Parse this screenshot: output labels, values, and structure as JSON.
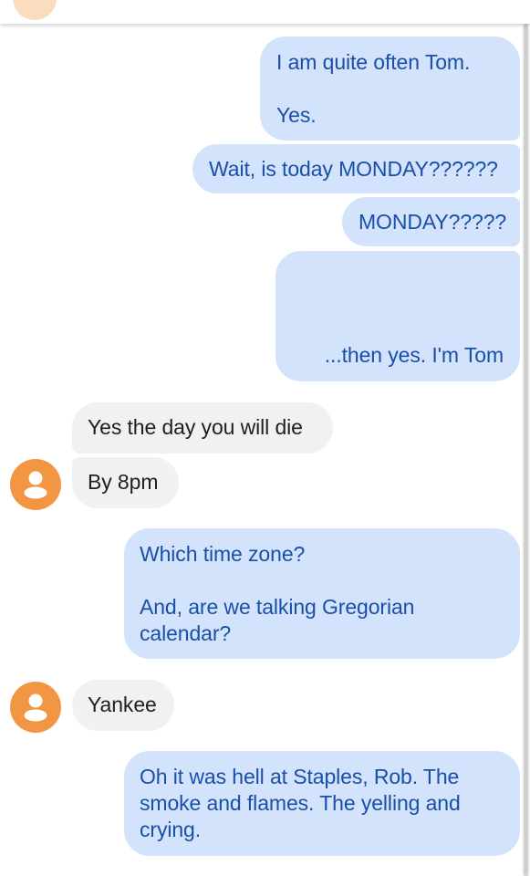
{
  "colors": {
    "outgoing_bubble": "#d3e3fc",
    "outgoing_text": "#1a4fa8",
    "incoming_bubble": "#f0f1f3",
    "incoming_text": "#1f1f1f",
    "avatar": "#f39644"
  },
  "messages": [
    {
      "direction": "outgoing",
      "text": "I am quite often Tom.\n\nYes."
    },
    {
      "direction": "outgoing",
      "text": "Wait, is today MONDAY??????"
    },
    {
      "direction": "outgoing",
      "text": "MONDAY?????"
    },
    {
      "direction": "outgoing",
      "text": "...then yes.  I'm Tom"
    },
    {
      "direction": "incoming",
      "text": "Yes the day you will die"
    },
    {
      "direction": "incoming",
      "text": "By 8pm",
      "avatar_icon": "person-icon"
    },
    {
      "direction": "outgoing",
      "text": "Which time zone?\n\nAnd, are we talking Gregorian\ncalendar?"
    },
    {
      "direction": "incoming",
      "text": "Yankee",
      "avatar_icon": "person-icon"
    },
    {
      "direction": "outgoing",
      "text": "Oh it was hell at Staples, Rob.  The\nsmoke and flames.  The yelling and\ncrying."
    }
  ]
}
